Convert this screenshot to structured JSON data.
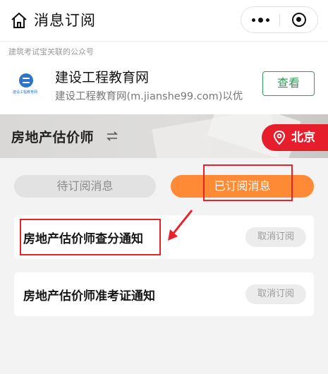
{
  "nav": {
    "title": "消息订阅"
  },
  "account": {
    "hint": "建筑考试宝关联的公众号",
    "name": "建设工程教育网",
    "description": "建设工程教育网(m.jianshe99.com)以优···",
    "logo_text": "建设工程教育网",
    "view_label": "查看"
  },
  "banner": {
    "category": "房地产估价师",
    "city": "北京"
  },
  "tabs": {
    "pending": "待订阅消息",
    "subscribed": "已订阅消息"
  },
  "items": [
    {
      "name": "房地产估价师查分通知",
      "action": "取消订阅"
    },
    {
      "name": "房地产估价师准考证通知",
      "action": "取消订阅"
    }
  ],
  "colors": {
    "accent_orange": "#ff8a35",
    "city_red": "#e61e2b",
    "view_green": "#2aa35a",
    "highlight_red": "#e8212a"
  },
  "icons": [
    "home-icon",
    "more-dots-icon",
    "close-target-icon",
    "swap-icon",
    "location-pin-icon",
    "arrow-annotation-icon"
  ]
}
